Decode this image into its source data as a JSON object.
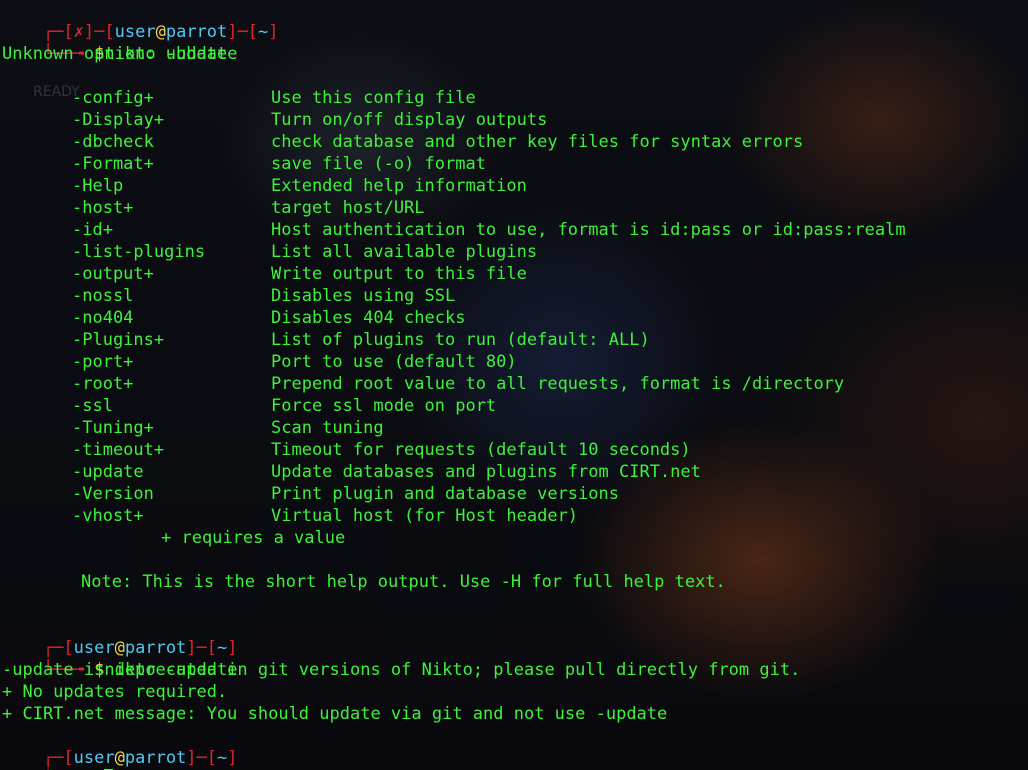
{
  "terminal": {
    "prompt1": {
      "bracket_open": "┌─[",
      "fail_mark": "✗",
      "bracket_mid": "]─[",
      "user": "user",
      "at": "@",
      "host": "parrot",
      "bracket_sep": "]─[",
      "cwd": "~",
      "bracket_close": "]",
      "arrow": "└──╼ ",
      "dollar": "$",
      "command": "nikto -ubdate"
    },
    "error_line": "Unknown option: ubdate",
    "options": [
      {
        "name": "-config+",
        "desc": "Use this config file"
      },
      {
        "name": "-Display+",
        "desc": "Turn on/off display outputs"
      },
      {
        "name": "-dbcheck",
        "desc": "check database and other key files for syntax errors"
      },
      {
        "name": "-Format+",
        "desc": "save file (-o) format"
      },
      {
        "name": "-Help",
        "desc": "Extended help information"
      },
      {
        "name": "-host+",
        "desc": "target host/URL"
      },
      {
        "name": "-id+",
        "desc": "Host authentication to use, format is id:pass or id:pass:realm"
      },
      {
        "name": "-list-plugins",
        "desc": "List all available plugins"
      },
      {
        "name": "-output+",
        "desc": "Write output to this file"
      },
      {
        "name": "-nossl",
        "desc": "Disables using SSL"
      },
      {
        "name": "-no404",
        "desc": "Disables 404 checks"
      },
      {
        "name": "-Plugins+",
        "desc": "List of plugins to run (default: ALL)"
      },
      {
        "name": "-port+",
        "desc": "Port to use (default 80)"
      },
      {
        "name": "-root+",
        "desc": "Prepend root value to all requests, format is /directory"
      },
      {
        "name": "-ssl",
        "desc": "Force ssl mode on port"
      },
      {
        "name": "-Tuning+",
        "desc": "Scan tuning"
      },
      {
        "name": "-timeout+",
        "desc": "Timeout for requests (default 10 seconds)"
      },
      {
        "name": "-update",
        "desc": "Update databases and plugins from CIRT.net"
      },
      {
        "name": "-Version",
        "desc": "Print plugin and database versions"
      },
      {
        "name": "-vhost+",
        "desc": "Virtual host (for Host header)"
      }
    ],
    "requires_value": "+ requires a value",
    "note": "Note: This is the short help output. Use -H for full help text.",
    "prompt2": {
      "bracket_open": "┌─[",
      "user": "user",
      "at": "@",
      "host": "parrot",
      "bracket_sep": "]─[",
      "cwd": "~",
      "bracket_close": "]",
      "arrow": "└──╼ ",
      "dollar": "$",
      "command": "nikto -update"
    },
    "update_output": [
      "-update is deprecated in git versions of Nikto; please pull directly from git.",
      "+ No updates required.",
      "+ CIRT.net message: You should update via git and not use -update"
    ],
    "prompt3": {
      "bracket_open": "┌─[",
      "user": "user",
      "at": "@",
      "host": "parrot",
      "bracket_sep": "]─[",
      "cwd": "~",
      "bracket_close": "]",
      "arrow": "└──╼ ",
      "dollar": "$"
    }
  },
  "background": {
    "ghost_text_1": "READY"
  },
  "colors": {
    "text_green": "#3ef13b",
    "prompt_red": "#e0242e",
    "host_cyan": "#52c8f2",
    "at_yellow": "#f2d64b",
    "background": "#0b0c10"
  }
}
